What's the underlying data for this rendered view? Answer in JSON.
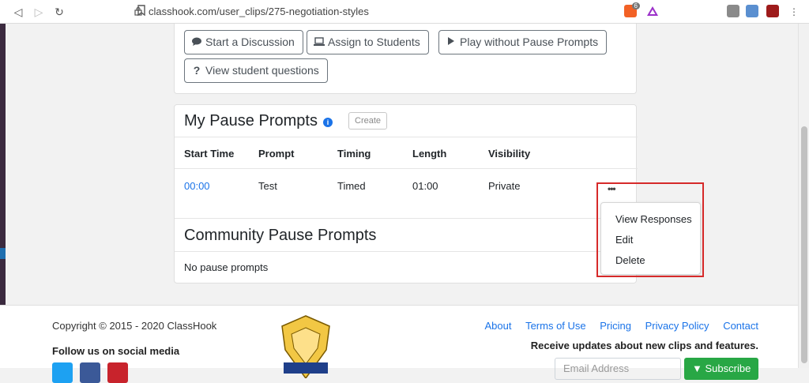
{
  "browser": {
    "url_text": "classhook.com/user_clips/275-negotiation-styles",
    "brave_badge": "6"
  },
  "actions": {
    "start_discussion": "Start a Discussion",
    "assign_students": "Assign to Students",
    "play_without_prompts": "Play without Pause Prompts",
    "view_questions": "View student questions"
  },
  "my_prompts": {
    "title": "My Pause Prompts",
    "create_label": "Create",
    "columns": [
      "Start Time",
      "Prompt",
      "Timing",
      "Length",
      "Visibility"
    ],
    "rows": [
      {
        "start_time": "00:00",
        "prompt": "Test",
        "timing": "Timed",
        "length": "01:00",
        "visibility": "Private"
      }
    ],
    "row_menu": {
      "dots": "•••",
      "items": [
        "View Responses",
        "Edit",
        "Delete"
      ]
    }
  },
  "community_prompts": {
    "title": "Community Pause Prompts",
    "empty_text": "No pause prompts"
  },
  "footer": {
    "copyright": "Copyright © 2015 - 2020 ClassHook",
    "follow": "Follow us on social media",
    "links": [
      "About",
      "Terms of Use",
      "Pricing",
      "Privacy Policy",
      "Contact"
    ],
    "receive": "Receive updates about new clips and features.",
    "email_placeholder": "Email Address",
    "subscribe": "Subscribe",
    "badge_text": {
      "org": "American Association of School Librarians",
      "abbr": "AASL",
      "best": "BEST"
    }
  },
  "colors": {
    "link": "#1a73e8",
    "highlight_border": "#d62a2a",
    "subscribe": "#28a745"
  }
}
